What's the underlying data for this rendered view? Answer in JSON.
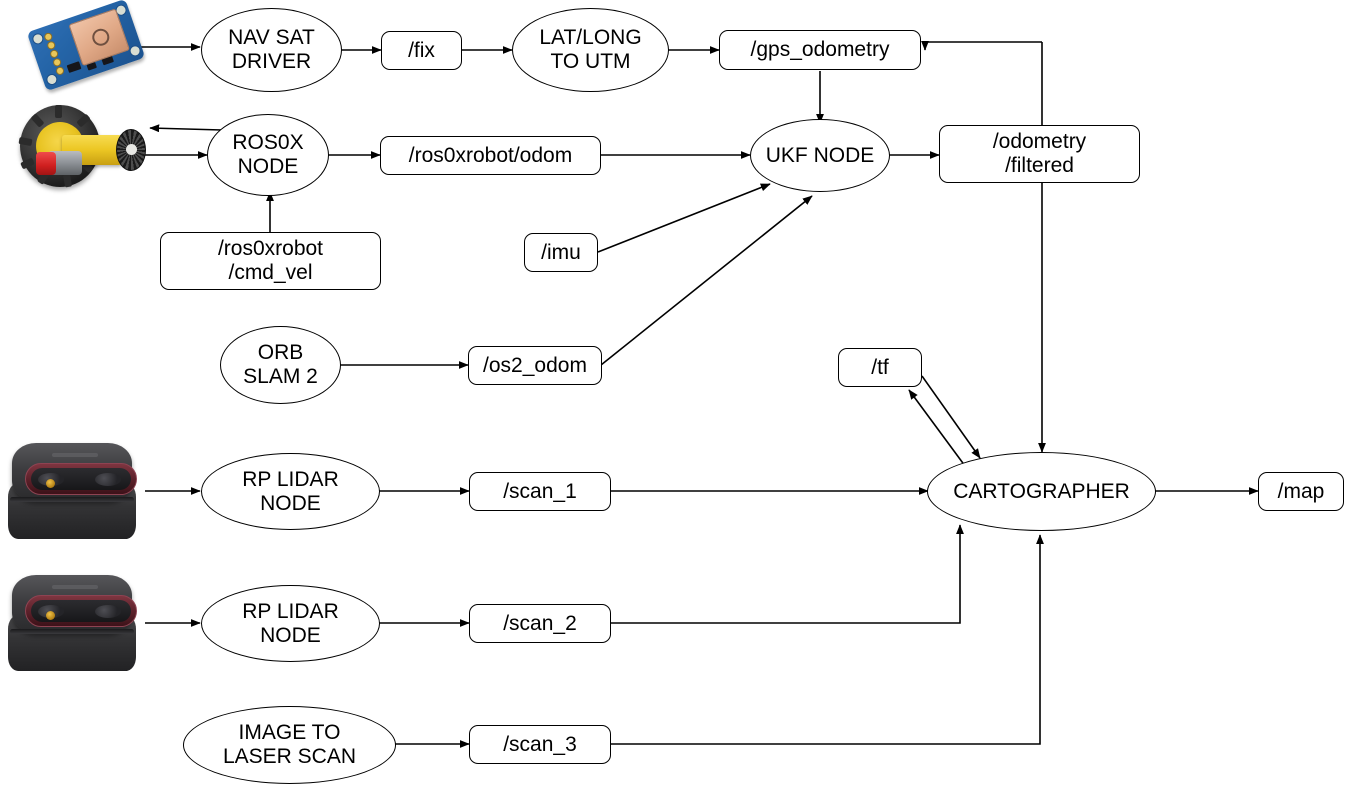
{
  "diagram": {
    "title": "ROS sensor fusion and mapping node graph",
    "stroke_color": "#000000",
    "background_color": "#ffffff"
  },
  "sensors": [
    {
      "name": "gps-module-image",
      "label": "GPS NEO module board"
    },
    {
      "name": "wheel-motor-image",
      "label": "TT gear motor with wheel and encoder"
    },
    {
      "name": "rplidar-image-1",
      "label": "RP LIDAR sensor"
    },
    {
      "name": "rplidar-image-2",
      "label": "RP LIDAR sensor"
    }
  ],
  "nodes": {
    "nav_sat_driver": "NAV SAT\nDRIVER",
    "lat_long_to_utm": "LAT/LONG\nTO UTM",
    "ros0x_node": "ROS0X\nNODE",
    "ukf_node": "UKF NODE",
    "orb_slam_2": "ORB\nSLAM 2",
    "rp_lidar_node_1": "RP LIDAR\nNODE",
    "rp_lidar_node_2": "RP LIDAR\nNODE",
    "image_to_laser_scan": "IMAGE TO\nLASER SCAN",
    "cartographer": "CARTOGRAPHER"
  },
  "topics": {
    "fix": "/fix",
    "gps_odometry": "/gps_odometry",
    "ros0xrobot_odom": "/ros0xrobot/odom",
    "ros0xrobot_cmd_vel": "/ros0xrobot\n/cmd_vel",
    "imu": "/imu",
    "os2_odom": "/os2_odom",
    "odometry_filtered": "/odometry\n/filtered",
    "tf": "/tf",
    "scan_1": "/scan_1",
    "scan_2": "/scan_2",
    "scan_3": "/scan_3",
    "map": "/map"
  },
  "edges": [
    {
      "from": "gps-module-image",
      "to": "nav_sat_driver"
    },
    {
      "from": "nav_sat_driver",
      "to": "fix"
    },
    {
      "from": "fix",
      "to": "lat_long_to_utm"
    },
    {
      "from": "lat_long_to_utm",
      "to": "gps_odometry"
    },
    {
      "from": "gps_odometry",
      "to": "ukf_node"
    },
    {
      "from": "odometry_filtered",
      "to": "gps_odometry"
    },
    {
      "from": "wheel-motor-image",
      "to": "ros0x_node"
    },
    {
      "from": "ros0x_node",
      "to": "wheel-motor-image"
    },
    {
      "from": "ros0x_node",
      "to": "ros0xrobot_odom"
    },
    {
      "from": "ros0xrobot_cmd_vel",
      "to": "ros0x_node"
    },
    {
      "from": "ros0xrobot_odom",
      "to": "ukf_node"
    },
    {
      "from": "imu",
      "to": "ukf_node"
    },
    {
      "from": "orb_slam_2",
      "to": "os2_odom"
    },
    {
      "from": "os2_odom",
      "to": "ukf_node"
    },
    {
      "from": "ukf_node",
      "to": "odometry_filtered"
    },
    {
      "from": "odometry_filtered",
      "to": "cartographer"
    },
    {
      "from": "tf",
      "to": "cartographer"
    },
    {
      "from": "cartographer",
      "to": "tf"
    },
    {
      "from": "rplidar-image-1",
      "to": "rp_lidar_node_1"
    },
    {
      "from": "rp_lidar_node_1",
      "to": "scan_1"
    },
    {
      "from": "scan_1",
      "to": "cartographer"
    },
    {
      "from": "rplidar-image-2",
      "to": "rp_lidar_node_2"
    },
    {
      "from": "rp_lidar_node_2",
      "to": "scan_2"
    },
    {
      "from": "scan_2",
      "to": "cartographer"
    },
    {
      "from": "image_to_laser_scan",
      "to": "scan_3"
    },
    {
      "from": "scan_3",
      "to": "cartographer"
    },
    {
      "from": "cartographer",
      "to": "map"
    }
  ]
}
